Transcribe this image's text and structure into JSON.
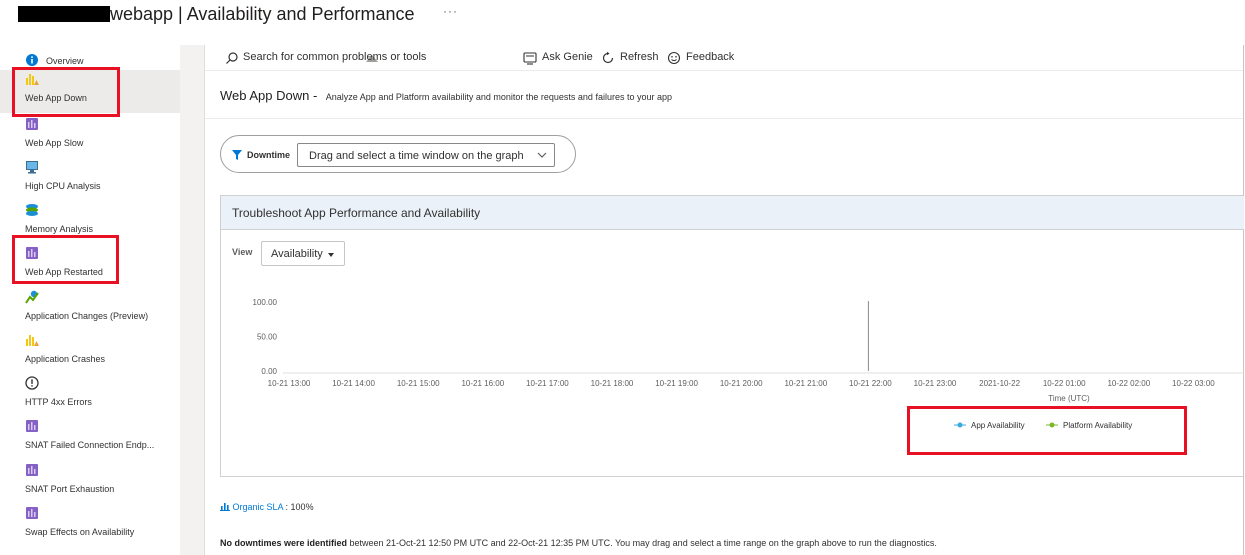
{
  "window": {
    "title": "webapp | Availability and Performance",
    "more": "···"
  },
  "sidebar": {
    "items": [
      {
        "label": "Overview",
        "icon": "info-icon"
      },
      {
        "label": "Web App Down",
        "icon": "bar-warning-icon",
        "selected": true
      },
      {
        "label": "Web App Slow",
        "icon": "purple-doc-icon"
      },
      {
        "label": "High CPU Analysis",
        "icon": "monitor-icon"
      },
      {
        "label": "Memory Analysis",
        "icon": "memory-stack-icon"
      },
      {
        "label": "Web App Restarted",
        "icon": "purple-doc-icon"
      },
      {
        "label": "Application Changes (Preview)",
        "icon": "changes-icon"
      },
      {
        "label": "Application Crashes",
        "icon": "bar-warning-icon"
      },
      {
        "label": "HTTP 4xx Errors",
        "icon": "exclamation-circle-icon"
      },
      {
        "label": "SNAT Failed Connection Endp...",
        "icon": "purple-doc-icon"
      },
      {
        "label": "SNAT Port Exhaustion",
        "icon": "purple-doc-icon"
      },
      {
        "label": "Swap Effects on Availability",
        "icon": "purple-doc-icon"
      }
    ]
  },
  "toolbar": {
    "search_placeholder": "Search for common problems or tools",
    "ask_genie": "Ask Genie",
    "refresh": "Refresh",
    "feedback": "Feedback"
  },
  "page": {
    "heading": "Web App Down",
    "separator": " -",
    "description": "Analyze App and Platform availability and monitor the requests and failures to your app"
  },
  "downtime": {
    "label": "Downtime",
    "select_text": "Drag and select a time window on the graph"
  },
  "card": {
    "title": "Troubleshoot App Performance and Availability",
    "view_label": "View",
    "view_value": "Availability"
  },
  "chart_data": {
    "type": "line",
    "x_ticks": [
      "10-21 13:00",
      "10-21 14:00",
      "10-21 15:00",
      "10-21 16:00",
      "10-21 17:00",
      "10-21 18:00",
      "10-21 19:00",
      "10-21 20:00",
      "10-21 21:00",
      "10-21 22:00",
      "10-21 23:00",
      "2021-10-22",
      "10-22 01:00",
      "10-22 02:00",
      "10-22 03:00"
    ],
    "y_ticks": [
      "100.00",
      "50.00",
      "0.00"
    ],
    "ylim": [
      0,
      100
    ],
    "xlabel": "Time (UTC)",
    "ylabel": "",
    "marker_at_tick": "10-21 22:00",
    "series": [
      {
        "name": "App Availability",
        "color": "#3ba9e0",
        "values": []
      },
      {
        "name": "Platform Availability",
        "color": "#7bb928",
        "values": []
      }
    ],
    "legend_position": "bottom-right"
  },
  "sla": {
    "label": "Organic SLA",
    "value": " : 100%"
  },
  "footer": {
    "bold": "No downtimes were identified",
    "rest": " between 21-Oct-21 12:50 PM UTC and 22-Oct-21 12:35 PM UTC. You may drag and select a time range on the graph above to run the diagnostics."
  },
  "colors": {
    "accent": "#0078d4",
    "highlight": "#e81123",
    "card_header": "#eaf1f8"
  }
}
